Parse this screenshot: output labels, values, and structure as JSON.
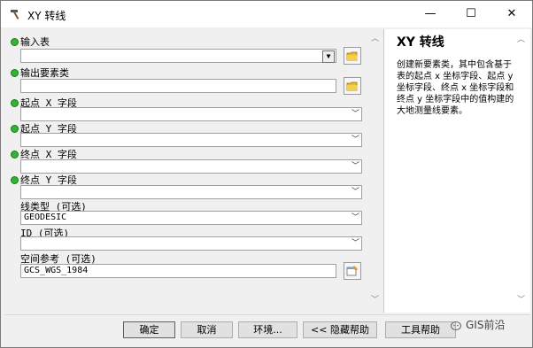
{
  "window": {
    "title": "XY 转线"
  },
  "titlebar": {
    "minimize": "—",
    "maximize": "☐",
    "close": "✕"
  },
  "fields": {
    "input_table": {
      "label": "输入表",
      "value": ""
    },
    "output_features": {
      "label": "输出要素类",
      "value": ""
    },
    "start_x": {
      "label": "起点 X 字段",
      "value": ""
    },
    "start_y": {
      "label": "起点 Y 字段",
      "value": ""
    },
    "end_x": {
      "label": "终点 X 字段",
      "value": ""
    },
    "end_y": {
      "label": "终点 Y 字段",
      "value": ""
    },
    "line_type": {
      "label": "线类型 (可选)",
      "value": "GEODESIC"
    },
    "id": {
      "label": "ID (可选)",
      "value": ""
    },
    "spatial_ref": {
      "label": "空间参考 (可选)",
      "value": "GCS_WGS_1984"
    }
  },
  "help": {
    "title": "XY 转线",
    "body": "创建新要素类，其中包含基于表的起点 x 坐标字段、起点 y 坐标字段、终点 x 坐标字段和终点 y 坐标字段中的值构建的大地测量线要素。"
  },
  "buttons": {
    "ok": "确定",
    "cancel": "取消",
    "environments": "环境...",
    "hide_help": "<< 隐藏帮助",
    "tool_help": "工具帮助"
  },
  "watermark": {
    "text": "GIS前沿"
  },
  "colors": {
    "required_dot": "#33b233",
    "primary_border": "#0078d7"
  }
}
